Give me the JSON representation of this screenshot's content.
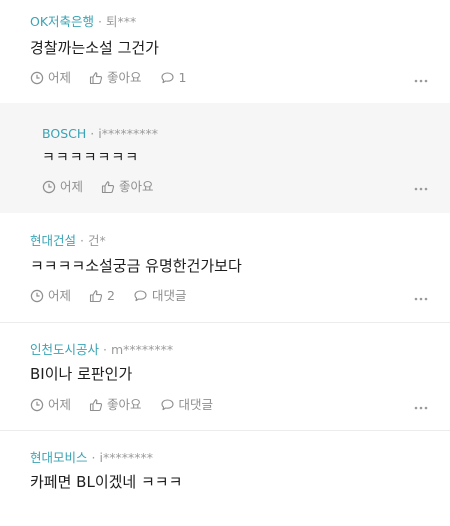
{
  "comments": [
    {
      "company": "OK저축은행",
      "user": "퇴***",
      "text": "경찰까는소설 그건가",
      "time": "어제",
      "like": "좋아요",
      "reply": "1"
    },
    {
      "company": "BOSCH",
      "user": "i*********",
      "text": "ㅋㅋㅋㅋㅋㅋㅋ",
      "time": "어제",
      "like": "좋아요"
    },
    {
      "company": "현대건설",
      "user": "건*",
      "text": "ㅋㅋㅋㅋ소설궁금 유명한건가보다",
      "time": "어제",
      "like": "2",
      "reply": "대댓글"
    },
    {
      "company": "인천도시공사",
      "user": "m********",
      "text": "BI이나 로판인가",
      "time": "어제",
      "like": "좋아요",
      "reply": "대댓글"
    },
    {
      "company": "현대모비스",
      "user": "i********",
      "text": "카페면 BL이겠네 ㅋㅋㅋ"
    }
  ],
  "separator": "·",
  "icons": {
    "time": "clock-icon",
    "like": "thumbs-up-icon",
    "reply": "speech-bubble-icon",
    "more": "more-dots-icon"
  },
  "colors": {
    "company": "#3aa3b5",
    "reply_bg": "#f6f6f7"
  }
}
